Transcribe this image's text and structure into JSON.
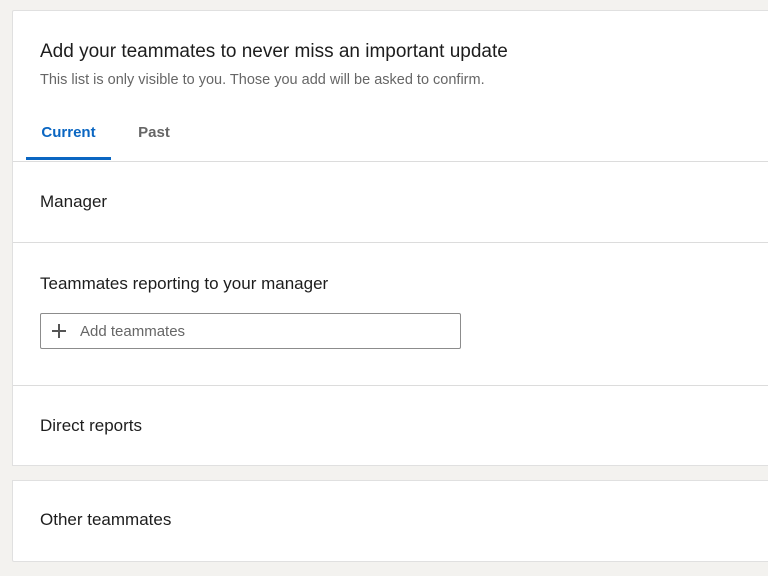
{
  "header": {
    "title": "Add your teammates to never miss an important update",
    "subtitle": "This list is only visible to you. Those you add will be asked to confirm."
  },
  "tabs": [
    {
      "label": "Current",
      "active": true
    },
    {
      "label": "Past",
      "active": false
    }
  ],
  "sections": {
    "manager": {
      "title": "Manager"
    },
    "teammates": {
      "title": "Teammates reporting to your manager",
      "add_placeholder": "Add teammates",
      "add_value": ""
    },
    "direct_reports": {
      "title": "Direct reports"
    },
    "other": {
      "title": "Other teammates"
    }
  },
  "colors": {
    "accent": "#0a66c2",
    "text_primary": "#1d1d1d",
    "text_secondary": "#666666",
    "page_background": "#f3f2ef",
    "card_background": "#ffffff"
  },
  "icons": {
    "add_input_icon": "plus-icon"
  }
}
